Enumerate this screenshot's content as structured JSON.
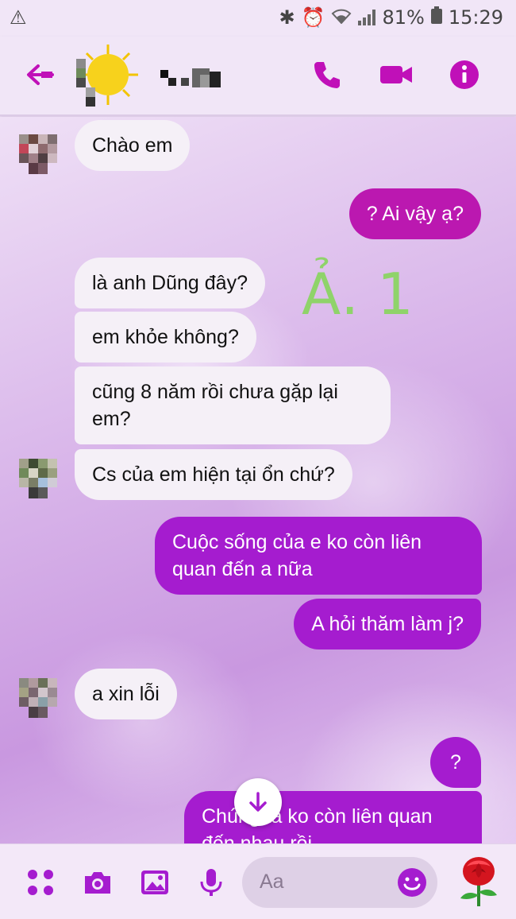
{
  "status_bar": {
    "battery": "81%",
    "time": "15:29"
  },
  "header": {
    "icons": [
      "back-arrow-icon",
      "phone-icon",
      "video-camera-icon",
      "info-icon"
    ],
    "accent_color": "#c010b8"
  },
  "messages": [
    {
      "side": "in",
      "text": "Chào em"
    },
    {
      "side": "out",
      "text": "? Ai vậy ạ?"
    },
    {
      "side": "in",
      "text": "là anh Dũng đây?"
    },
    {
      "side": "in",
      "text": "em khỏe không?"
    },
    {
      "side": "in",
      "lines": [
        "cũng 8 năm rồi chưa gặp lại",
        "em?"
      ]
    },
    {
      "side": "in",
      "text": "Cs của em hiện tại ổn chứ?"
    },
    {
      "side": "out",
      "lines": [
        "Cuộc sống của e ko còn liên",
        "quan đến a nữa"
      ]
    },
    {
      "side": "out",
      "text": "A hỏi thăm làm j?"
    },
    {
      "side": "in",
      "text": "a xin lỗi"
    },
    {
      "side": "out",
      "text": "?"
    },
    {
      "side": "out",
      "lines": [
        "Chúng ta ko còn liên quan",
        "đến nhau  rồi"
      ]
    }
  ],
  "annotation": "Ả. 1",
  "composer": {
    "placeholder": "Aa",
    "icons": [
      "apps-grid-icon",
      "camera-icon",
      "image-icon",
      "microphone-icon",
      "emoji-icon",
      "rose-icon"
    ]
  },
  "colors": {
    "outgoing_pink": "#bb18b0",
    "outgoing_purple": "#a51ccf",
    "incoming": "#f5f0f7",
    "annotation_green": "#8fd36a"
  }
}
